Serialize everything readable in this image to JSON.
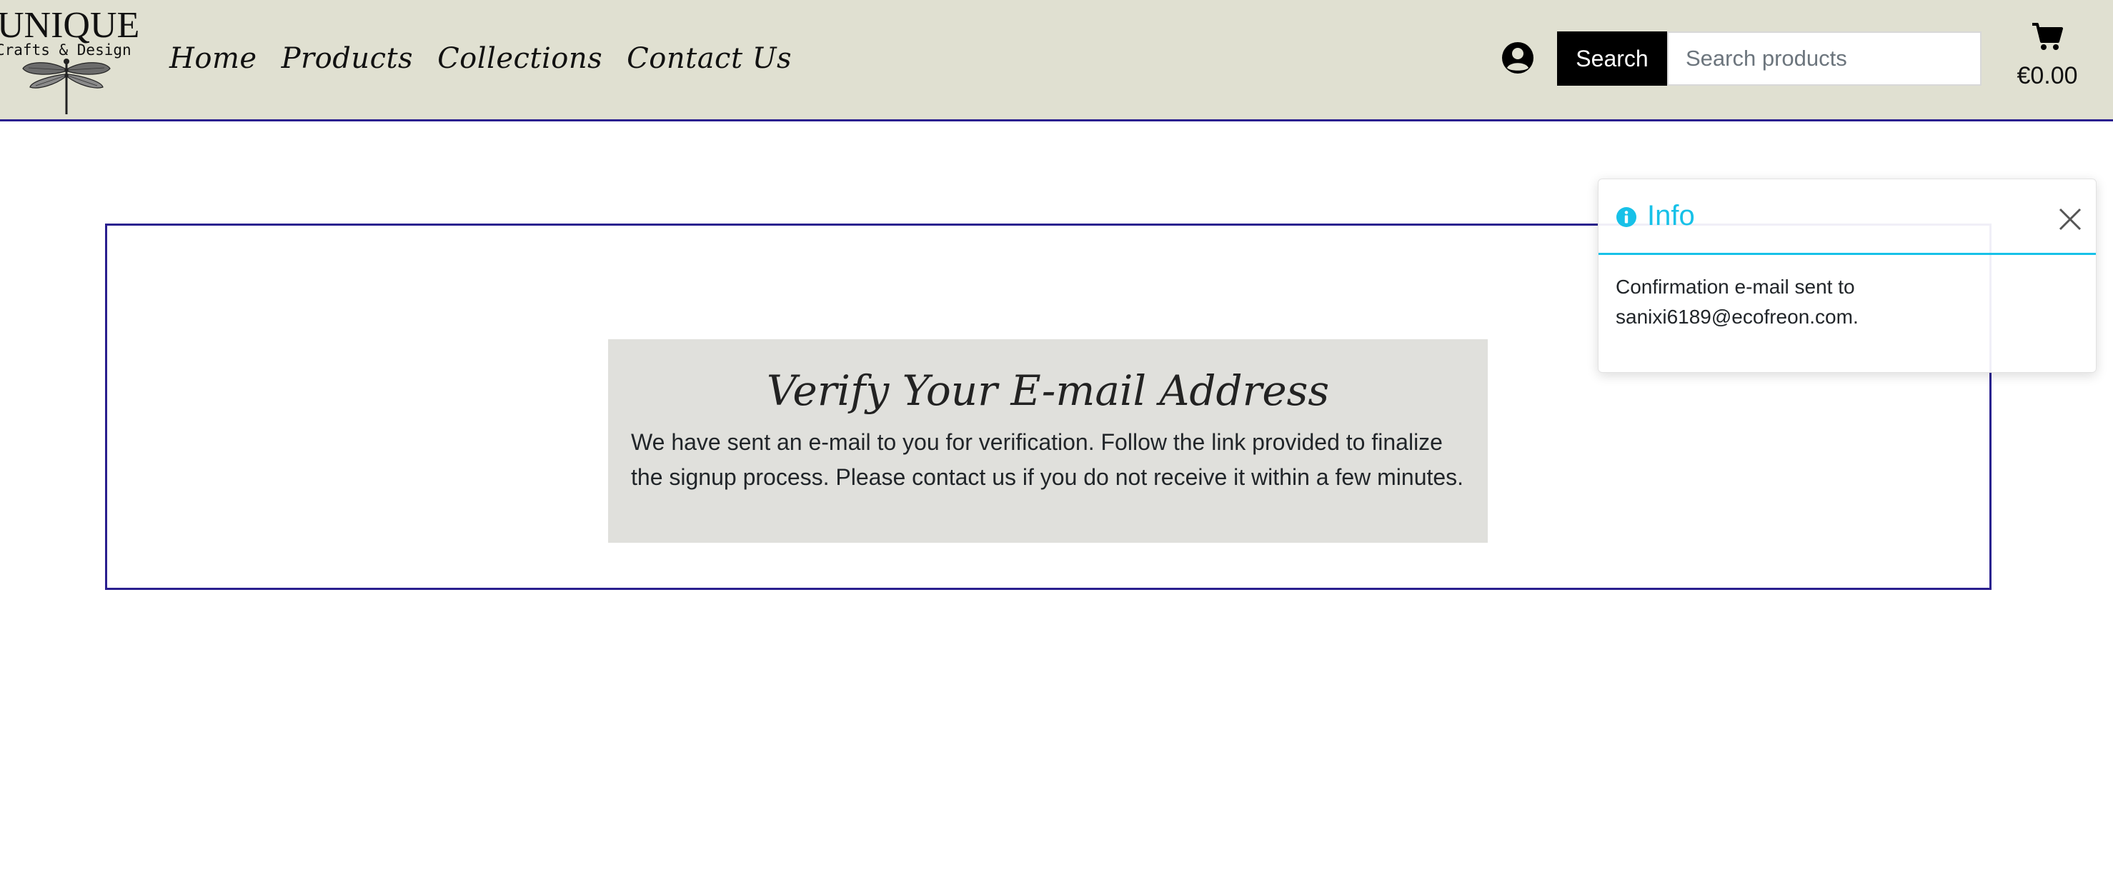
{
  "header": {
    "logo": {
      "title": "UNIQUE",
      "subtitle": "Crafts & Design",
      "image_icon": "dragonfly-icon"
    },
    "nav": [
      {
        "label": "Home"
      },
      {
        "label": "Products"
      },
      {
        "label": "Collections"
      },
      {
        "label": "Contact Us"
      }
    ],
    "account_icon": "user-circle-icon",
    "search": {
      "button_label": "Search",
      "placeholder": "Search products",
      "value": ""
    },
    "cart": {
      "icon": "shopping-cart-icon",
      "total": "€0.00"
    },
    "colors": {
      "background": "#e0e0d1",
      "border": "#2a1f8f"
    }
  },
  "main": {
    "title": "Verify Your E-mail Address",
    "message": "We have sent an e-mail to you for verification. Follow the link provided to finalize the signup process. Please contact us if you do not receive it within a few minutes.",
    "colors": {
      "frame_border": "#2a1f8f",
      "card_background": "#e0e0dc"
    }
  },
  "toast": {
    "icon": "info-circle-icon",
    "title": "Info",
    "message": "Confirmation e-mail sent to sanixi6189@ecofreon.com.",
    "close_icon": "close-icon",
    "colors": {
      "accent": "#17c1e8"
    }
  }
}
